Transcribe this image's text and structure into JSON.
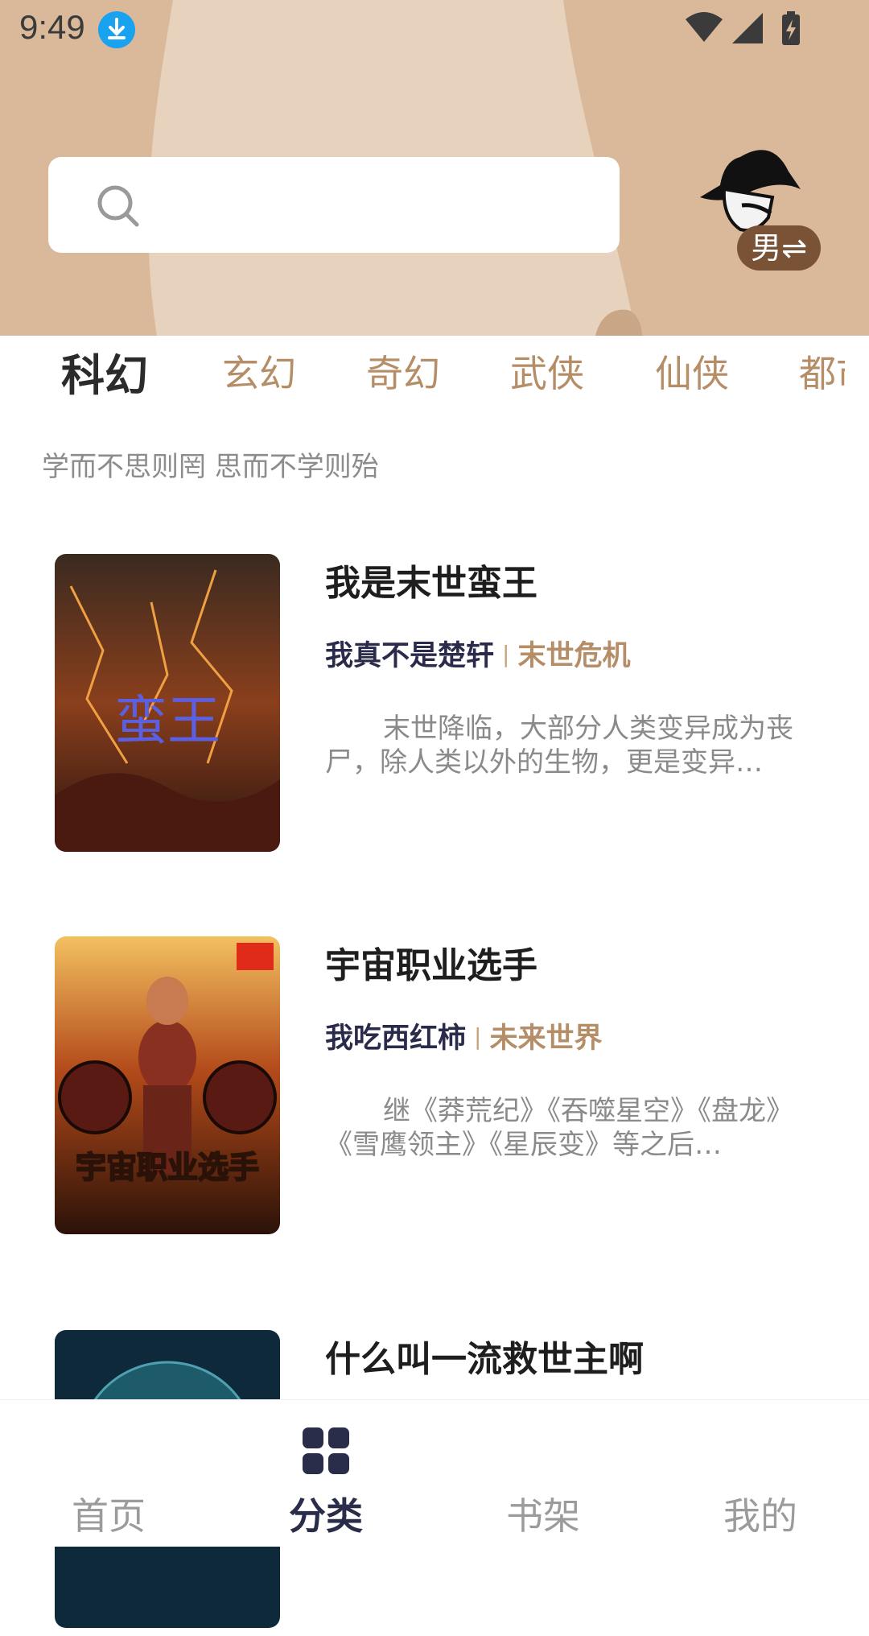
{
  "status_bar": {
    "time": "9:49"
  },
  "header": {
    "search": {
      "placeholder": ""
    },
    "gender_toggle": "男⇌"
  },
  "tabs": [
    {
      "label": "科幻",
      "active": true
    },
    {
      "label": "玄幻",
      "active": false
    },
    {
      "label": "奇幻",
      "active": false
    },
    {
      "label": "武侠",
      "active": false
    },
    {
      "label": "仙侠",
      "active": false
    },
    {
      "label": "都市",
      "active": false
    }
  ],
  "motto": "学而不思则罔 思而不学则殆",
  "books": [
    {
      "title": "我是末世蛮王",
      "author": "我真不是楚轩",
      "separator": "|",
      "genre": "末世危机",
      "description": "末世降临，大部分人类变异成为丧尸，除人类以外的生物，更是变异…",
      "cover_text": "蛮王"
    },
    {
      "title": "宇宙职业选手",
      "author": "我吃西红柿",
      "separator": "|",
      "genre": "未来世界",
      "description": "继《莽荒纪》《吞噬星空》《盘龙》《雪鹰领主》《星辰变》等之后…",
      "cover_text": "宇宙职业选手"
    },
    {
      "title": "什么叫一流救世主啊",
      "author": "",
      "separator": "",
      "genre": "",
      "description": "",
      "cover_text": ""
    }
  ],
  "bottom_nav": [
    {
      "label": "首页",
      "active": false
    },
    {
      "label": "分类",
      "active": true,
      "icon": "grid-icon"
    },
    {
      "label": "书架",
      "active": false
    },
    {
      "label": "我的",
      "active": false
    }
  ],
  "colors": {
    "header_bg": "#d9b99a",
    "accent": "#b58d66",
    "active_nav": "#2a2d4a"
  }
}
